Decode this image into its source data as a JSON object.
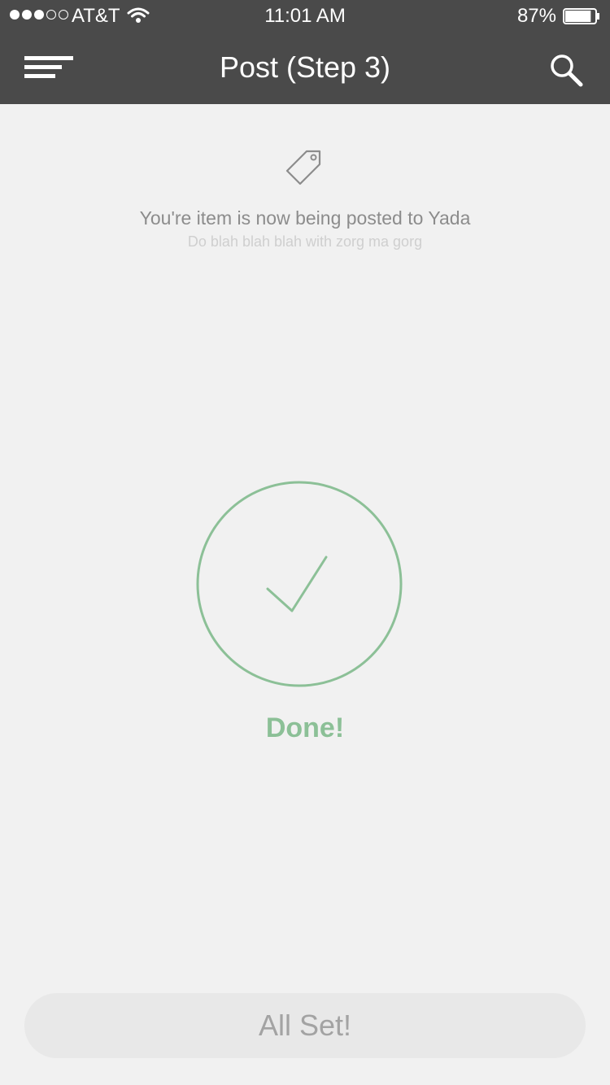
{
  "status_bar": {
    "carrier": "AT&T",
    "time": "11:01 AM",
    "battery_percent": "87%",
    "battery_level": 0.87,
    "signal_bars_filled": 3,
    "signal_bars_total": 5,
    "icons": [
      "wifi-icon",
      "battery-icon"
    ]
  },
  "nav": {
    "title": "Post (Step 3)",
    "menu_icon": "hamburger-menu-icon",
    "search_icon": "search-icon"
  },
  "intro": {
    "icon": "price-tag-icon",
    "title": "You're item is now being posted to Yada",
    "subtitle": "Do blah blah blah with zorg ma gorg"
  },
  "status": {
    "icon": "checkmark-icon",
    "label": "Done!"
  },
  "footer": {
    "button_label": "All Set!"
  },
  "colors": {
    "header_bg": "#4a4a4a",
    "page_bg": "#f1f1f1",
    "accent_green": "#8cc097",
    "button_bg": "#e8e8e8"
  }
}
